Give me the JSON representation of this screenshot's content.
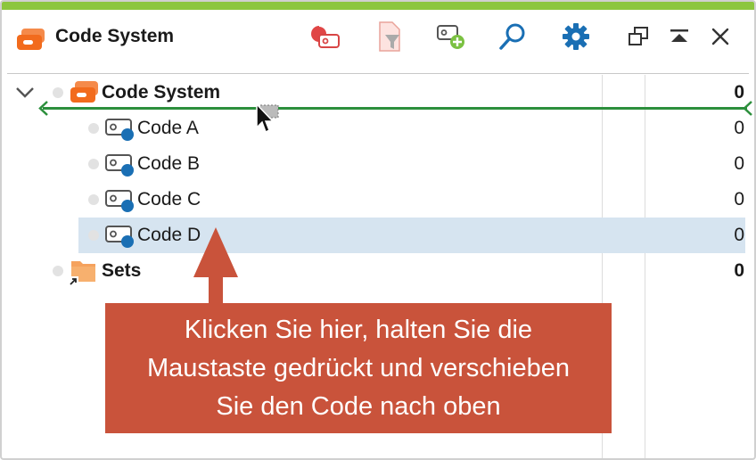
{
  "window": {
    "title": "Code System",
    "accent_color": "#8cc63f",
    "toolbar": {
      "icons": [
        "codes-reset-icon",
        "filter-icon",
        "new-code-icon",
        "search-icon",
        "settings-icon",
        "undock-icon",
        "collapse-icon",
        "close-icon"
      ]
    }
  },
  "tree": {
    "root": {
      "label": "Code System",
      "count": "0"
    },
    "codes": [
      {
        "label": "Code A",
        "count": "0"
      },
      {
        "label": "Code B",
        "count": "0"
      },
      {
        "label": "Code C",
        "count": "0"
      },
      {
        "label": "Code D",
        "count": "0",
        "selected": true
      }
    ],
    "sets": {
      "label": "Sets",
      "count": "0"
    }
  },
  "callout": {
    "lines": [
      "Klicken Sie hier, halten Sie die",
      "Maustaste gedrückt und verschieben",
      "Sie den Code nach oben"
    ],
    "color": "#c9533b"
  },
  "colors": {
    "selection": "#d6e4f0",
    "drop_indicator": "#2c8f3c",
    "code_dot": "#1a6fb4",
    "folder": "#f5a25d",
    "code_system_icon": "#f26b1d"
  }
}
